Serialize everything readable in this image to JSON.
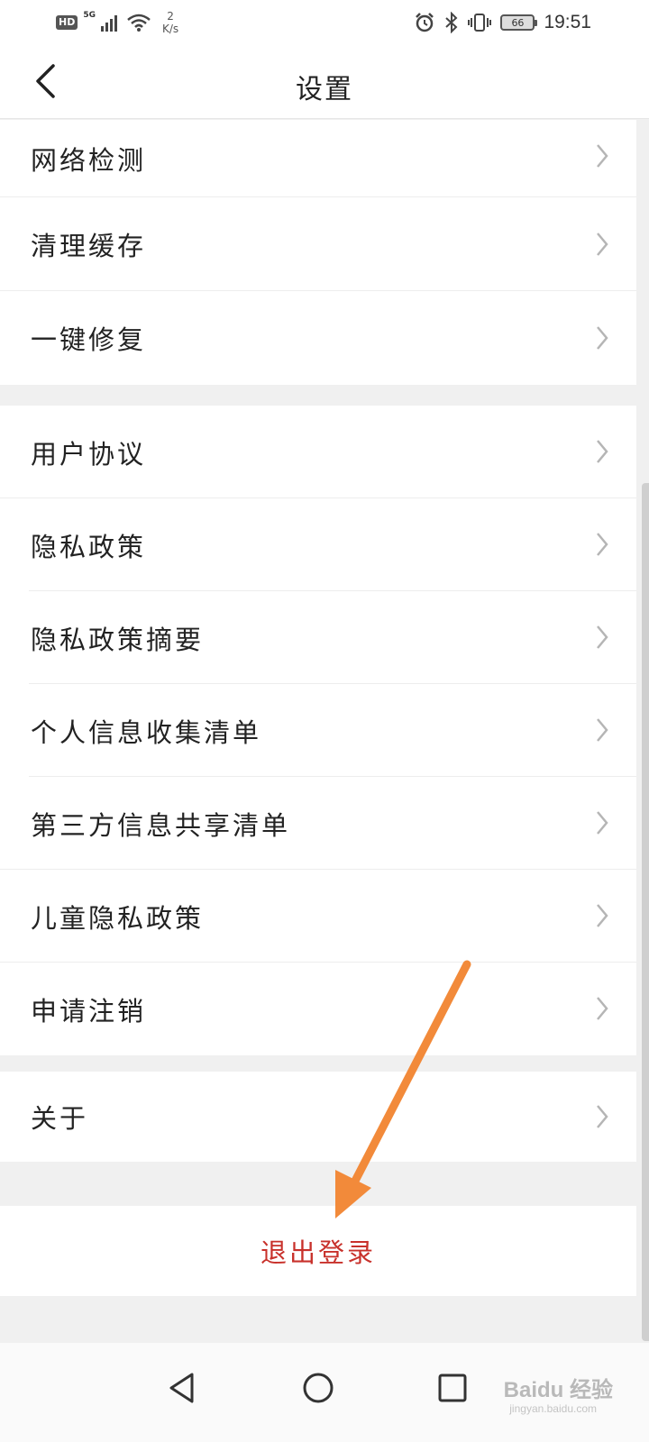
{
  "status_bar": {
    "hd": "HD",
    "network": "5G",
    "net_speed_value": "2",
    "net_speed_unit": "K/s",
    "battery": "66",
    "time": "19:51",
    "icons": [
      "signal-icon",
      "wifi-icon",
      "alarm-icon",
      "bluetooth-icon",
      "vibrate-icon",
      "battery-icon"
    ]
  },
  "header": {
    "title": "设置"
  },
  "groups": [
    {
      "items": [
        {
          "label": "网络检测"
        },
        {
          "label": "清理缓存"
        },
        {
          "label": "一键修复"
        }
      ]
    },
    {
      "items": [
        {
          "label": "用户协议"
        },
        {
          "label": "隐私政策"
        },
        {
          "label": "隐私政策摘要"
        },
        {
          "label": "个人信息收集清单"
        },
        {
          "label": "第三方信息共享清单"
        },
        {
          "label": "儿童隐私政策"
        },
        {
          "label": "申请注销"
        }
      ]
    },
    {
      "items": [
        {
          "label": "关于"
        }
      ]
    }
  ],
  "logout": {
    "label": "退出登录",
    "color": "#c8312b"
  },
  "annotation": {
    "arrow_color": "#f28a3a"
  },
  "watermark": {
    "text": "Baidu 经验",
    "sub": "jingyan.baidu.com"
  }
}
